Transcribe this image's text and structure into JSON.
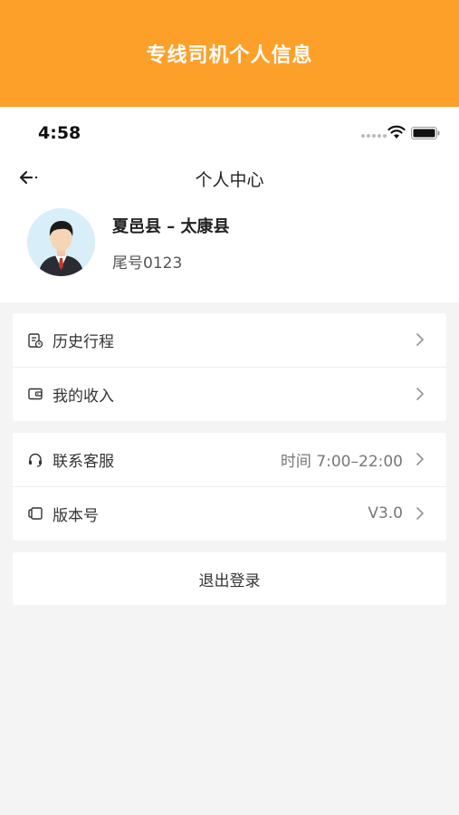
{
  "banner": {
    "title": "专线司机个人信息"
  },
  "status_bar": {
    "time": "4:58"
  },
  "nav": {
    "title": "个人中心"
  },
  "profile": {
    "route": "夏邑县 – 太康县",
    "plate_tail": "尾号0123"
  },
  "menu_group1": [
    {
      "label": "历史行程",
      "icon": "history-icon"
    },
    {
      "label": "我的收入",
      "icon": "wallet-icon"
    }
  ],
  "menu_group2": [
    {
      "label": "联系客服",
      "value": "时间 7:00–22:00",
      "icon": "headset-icon"
    },
    {
      "label": "版本号",
      "value": "V3.0",
      "icon": "version-icon"
    }
  ],
  "logout": {
    "label": "退出登录"
  },
  "colors": {
    "accent": "#fda02a",
    "background": "#f4f4f4",
    "card": "#ffffff"
  }
}
